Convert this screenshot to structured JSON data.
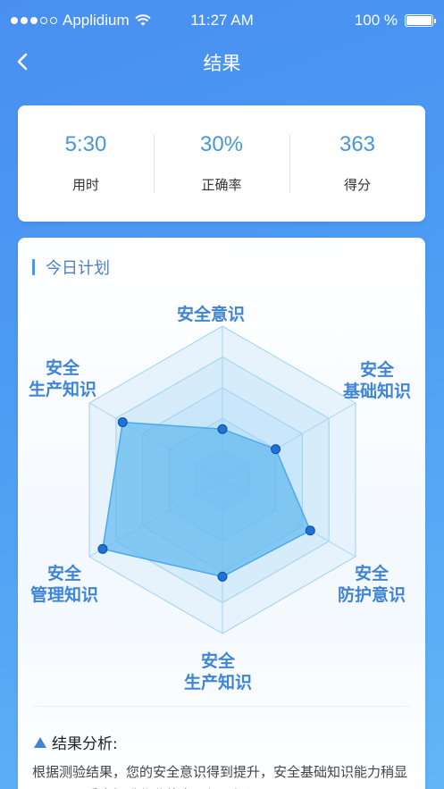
{
  "status_bar": {
    "carrier": "Applidium",
    "time": "11:27 AM",
    "battery": "100 %"
  },
  "nav": {
    "title": "结果"
  },
  "stats": [
    {
      "value": "5:30",
      "label": "用时"
    },
    {
      "value": "30%",
      "label": "正确率"
    },
    {
      "value": "363",
      "label": "得分"
    }
  ],
  "plan": {
    "title": "今日计划",
    "radar_labels": {
      "top": "安全意识",
      "top_right_1": "安全",
      "top_right_2": "基础知识",
      "bottom_right_1": "安全",
      "bottom_right_2": "防护意识",
      "bottom_1": "安全",
      "bottom_2": "生产知识",
      "bottom_left_1": "安全",
      "bottom_left_2": "管理知识",
      "top_left_1": "安全",
      "top_left_2": "生产知识"
    },
    "radar_values": [
      0.33,
      0.4,
      0.66,
      0.63,
      0.9,
      0.75
    ],
    "radar_levels": 5
  },
  "analysis": {
    "title": "结果分析:",
    "text": "根据测验结果，您的安全意识得到提升，安全基础知识能力稍显不足，需重点提升作业能力，加强提问"
  },
  "colors": {
    "accent": "#3f84d8",
    "stat_value": "#4a96d8",
    "radar_fill": "#5fb8ef",
    "radar_point": "#1f73d6"
  }
}
